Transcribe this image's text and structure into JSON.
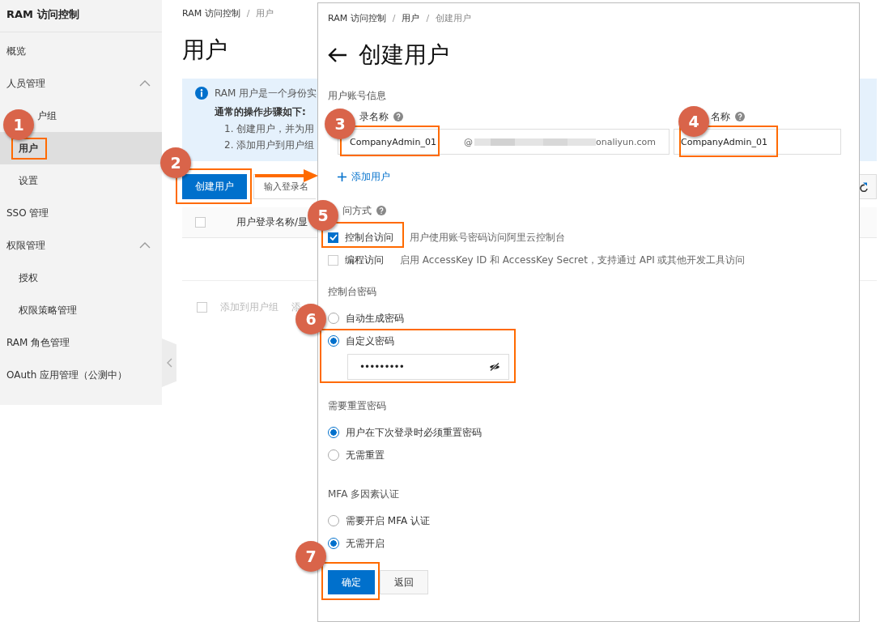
{
  "sidebar": {
    "title": "RAM 访问控制",
    "items": [
      {
        "label": "概览",
        "kind": "item",
        "selected": false
      },
      {
        "label": "人员管理",
        "kind": "group",
        "expanded": true,
        "children": [
          {
            "label": "户组",
            "selected": false,
            "covered": true
          },
          {
            "label": "用户",
            "selected": true
          },
          {
            "label": "设置",
            "selected": false
          }
        ]
      },
      {
        "label": "SSO 管理",
        "kind": "item",
        "selected": false
      },
      {
        "label": "权限管理",
        "kind": "group",
        "expanded": true,
        "children": [
          {
            "label": "授权",
            "selected": false
          },
          {
            "label": "权限策略管理",
            "selected": false
          }
        ]
      },
      {
        "label": "RAM 角色管理",
        "kind": "item",
        "selected": false
      },
      {
        "label": "OAuth 应用管理（公测中）",
        "kind": "item",
        "selected": false
      }
    ]
  },
  "main": {
    "breadcrumb": [
      {
        "label": "RAM 访问控制"
      },
      {
        "separator": "/",
        "label": "用户"
      }
    ],
    "title": "用户",
    "info": {
      "lead": "RAM 用户是一个身份实",
      "heading": "通常的操作步骤如下:",
      "steps": [
        "1. 创建用户，并为用",
        "2. 添加用户到用户组"
      ]
    },
    "create_button": "创建用户",
    "search": {
      "placeholder": "输入登录名"
    },
    "table": {
      "select_all": {
        "checked": false
      },
      "columns": [
        "用户登录名称/显"
      ]
    },
    "bulk": {
      "select_all": {
        "checked": false
      },
      "actions": [
        "添加到用户组",
        "添"
      ]
    }
  },
  "panel": {
    "breadcrumb": [
      {
        "label": "RAM 访问控制"
      },
      {
        "separator": "/",
        "label": "用户"
      },
      {
        "separator": "/",
        "label": "创建用户"
      }
    ],
    "title": "创建用户",
    "account_section": "用户账号信息",
    "login_label": "录名称",
    "login_value": "CompanyAdmin_01",
    "domain_at": "@",
    "domain": "onaliyun.com",
    "display_label": "名称",
    "display_value": "CompanyAdmin_01",
    "add_user": "添加用户",
    "access_label": "问方式",
    "access_options": [
      {
        "label": "控制台访问",
        "hint": "用户使用账号密码访问阿里云控制台",
        "checked": true
      },
      {
        "label": "编程访问",
        "hint": "启用 AccessKey ID 和 AccessKey Secret，支持通过 API 或其他开发工具访问",
        "checked": false
      }
    ],
    "password_section": "控制台密码",
    "password_options": [
      {
        "label": "自动生成密码",
        "selected": false
      },
      {
        "label": "自定义密码",
        "selected": true
      }
    ],
    "password_value": "•••••••••",
    "reset_section": "需要重置密码",
    "reset_options": [
      {
        "label": "用户在下次登录时必须重置密码",
        "selected": true
      },
      {
        "label": "无需重置",
        "selected": false
      }
    ],
    "mfa_section": "MFA 多因素认证",
    "mfa_options": [
      {
        "label": "需要开启 MFA 认证",
        "selected": false
      },
      {
        "label": "无需开启",
        "selected": true
      }
    ],
    "buttons": [
      {
        "label": "确定",
        "kind": "primary"
      },
      {
        "label": "返回",
        "kind": "default"
      }
    ]
  },
  "callouts": [
    "1",
    "2",
    "3",
    "4",
    "5",
    "6",
    "7"
  ]
}
